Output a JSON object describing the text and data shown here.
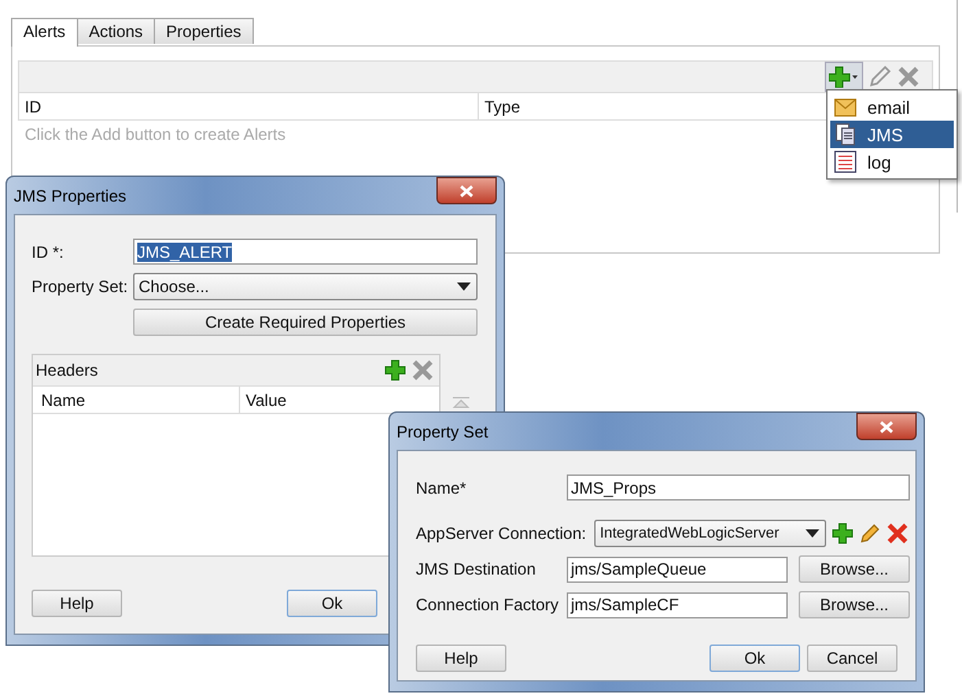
{
  "main_panel": {
    "tabs": [
      {
        "label": "Alerts",
        "selected": true
      },
      {
        "label": "Actions",
        "selected": false
      },
      {
        "label": "Properties",
        "selected": false
      }
    ],
    "table": {
      "columns": [
        "ID",
        "Type"
      ],
      "empty_message": "Click the Add button to create Alerts"
    },
    "add_menu": {
      "items": [
        {
          "label": "email",
          "kind": "email",
          "selected": false
        },
        {
          "label": "JMS",
          "kind": "jms",
          "selected": true
        },
        {
          "label": "log",
          "kind": "log",
          "selected": false
        }
      ]
    }
  },
  "jms_dialog": {
    "title": "JMS Properties",
    "id_label": "ID *:",
    "id_value": "JMS_ALERT",
    "id_value_selected": true,
    "property_set_label": "Property Set:",
    "property_set_value": "Choose...",
    "create_button": "Create Required Properties",
    "headers": {
      "title": "Headers",
      "columns": [
        "Name",
        "Value"
      ]
    },
    "buttons": [
      {
        "label": "Help",
        "default": false
      },
      {
        "label": "Ok",
        "default": true
      }
    ]
  },
  "property_set_dialog": {
    "title": "Property Set",
    "name_label": "Name*",
    "name_value": "JMS_Props",
    "connection_label": "AppServer Connection:",
    "connection_value": "IntegratedWebLogicServer",
    "fields": [
      {
        "label": "JMS Destination",
        "value": "jms/SampleQueue",
        "button": "Browse..."
      },
      {
        "label": "Connection Factory",
        "value": "jms/SampleCF",
        "button": "Browse..."
      }
    ],
    "buttons": [
      {
        "label": "Help",
        "default": false
      },
      {
        "label": "Ok",
        "default": true
      },
      {
        "label": "Cancel",
        "default": false
      }
    ]
  }
}
